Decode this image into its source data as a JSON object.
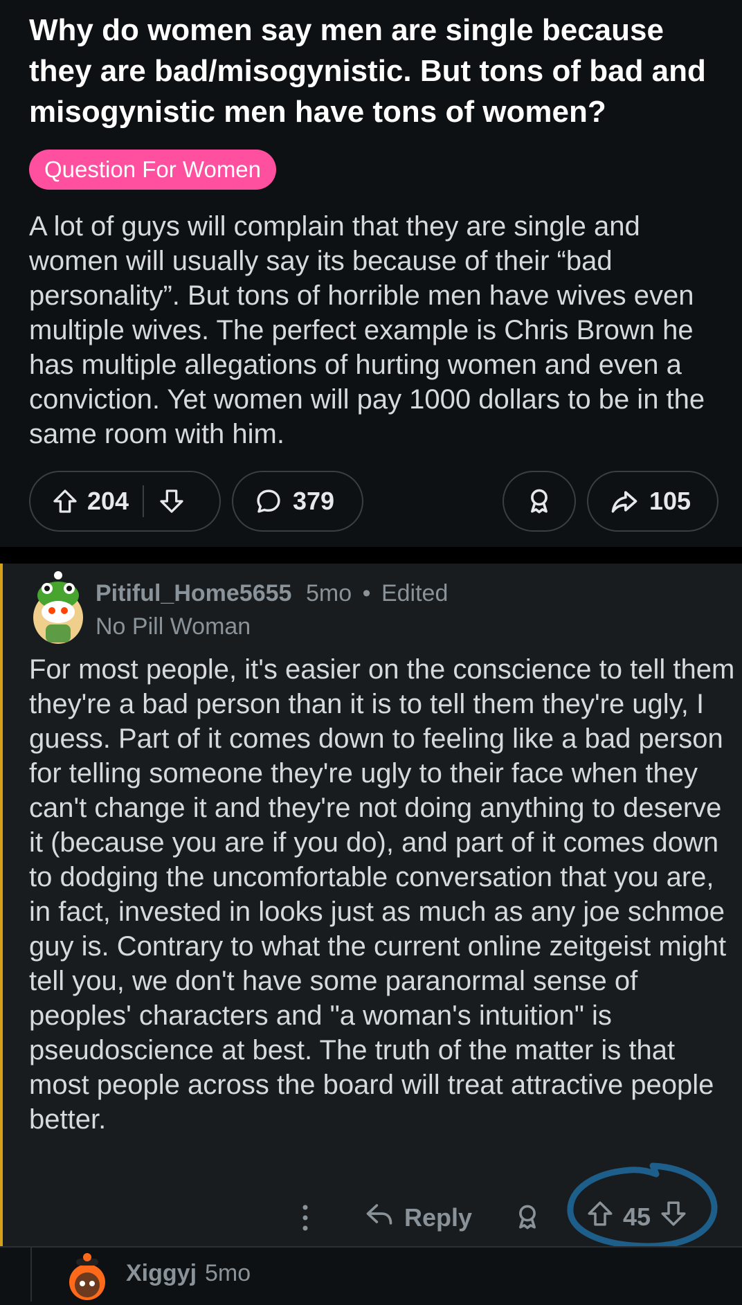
{
  "post": {
    "title": "Why do women say men are single because they are bad/misogynistic. But tons of bad and misogynistic men have tons of women?",
    "flair": "Question For Women",
    "body": "A lot of guys will complain that they are single and women will usually say its because of their “bad personality”. But tons of horrible men have wives even multiple wives. The perfect example is Chris Brown he has multiple allegations of hurting women and even a conviction. Yet women will pay 1000 dollars to be in the same room with him.",
    "votes": "204",
    "comments": "379",
    "shares": "105"
  },
  "comment": {
    "username": "Pitiful_Home5655",
    "age": "5mo",
    "separator": "•",
    "edited": "Edited",
    "user_flair": "No Pill Woman",
    "body": "For most people, it's easier on the conscience to tell them they're a bad person than it is to tell them they're ugly, I guess. Part of it comes down to feeling like a bad person for telling someone they're ugly to their face when they can't change it and they're not doing anything to deserve it (because you are if you do), and part of it comes down to dodging the uncomfortable conversation that you are, in fact, invested in looks just as much as any joe schmoe guy is. Contrary to what the current online zeitgeist might tell you, we don't have some paranormal sense of peoples' characters and \"a woman's intuition\" is pseudoscience at best. The truth of the matter is that most people across the board will treat attractive people better.",
    "reply_label": "Reply",
    "votes": "45"
  },
  "reply": {
    "username": "Xiggyj",
    "age": "5mo"
  },
  "colors": {
    "background": "#0e1113",
    "comment_background": "#181c1f",
    "flair": "#ff4f9f",
    "thread_highlight": "#d4a017",
    "annotation_circle": "#1d5f8a"
  },
  "icons": [
    "upvote-icon",
    "downvote-icon",
    "comment-icon",
    "award-icon",
    "share-icon",
    "more-icon",
    "reply-icon"
  ]
}
